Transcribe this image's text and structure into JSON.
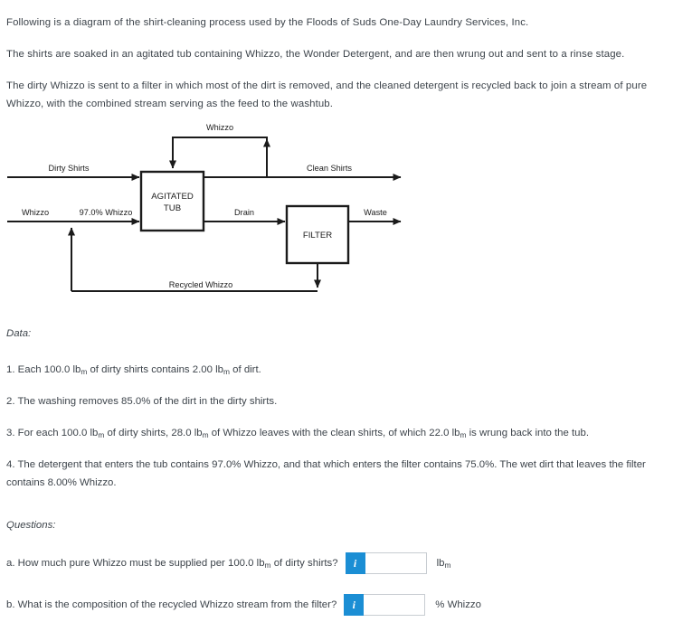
{
  "intro": {
    "p1": "Following is a diagram of the shirt-cleaning process used by the Floods of Suds One-Day Laundry Services, Inc.",
    "p2": "The shirts are soaked in an agitated tub containing Whizzo, the Wonder Detergent, and are then wrung out and sent to a rinse stage.",
    "p3": "The dirty Whizzo is sent to a filter in which most of the dirt is removed, and the cleaned detergent is recycled back to join a stream of pure Whizzo, with the combined stream serving as the feed to the washtub."
  },
  "diagram": {
    "units": {
      "tub": "AGITATED",
      "tub_line2": "TUB",
      "filter": "FILTER"
    },
    "streams": {
      "whizzo_recycle_top": "Whizzo",
      "dirty_shirts": "Dirty Shirts",
      "clean_shirts": "Clean Shirts",
      "whizzo_feed": "Whizzo",
      "mixed_feed": "97.0% Whizzo",
      "drain": "Drain",
      "waste": "Waste",
      "recycled_whizzo": "Recycled Whizzo"
    }
  },
  "data_section": {
    "heading": "Data:",
    "items": [
      {
        "pre": "1. Each 100.0 lb",
        "sub1": "m",
        "mid": " of dirty shirts contains 2.00 lb",
        "sub2": "m",
        "post": " of dirt."
      },
      {
        "pre": "2. The washing removes 85.0% of the dirt in the dirty shirts.",
        "sub1": "",
        "mid": "",
        "sub2": "",
        "post": ""
      },
      {
        "pre": "3. For each 100.0 lb",
        "sub1": "m",
        "mid": " of dirty shirts, 28.0 lb",
        "sub2": "m",
        "post": " of Whizzo leaves with the clean shirts, of which 22.0 lb",
        "sub3": "m",
        "post2": " is wrung back into the tub."
      },
      {
        "pre": "4. The detergent that enters the tub contains 97.0% Whizzo, and that which enters the filter contains 75.0%. The wet dirt that leaves the filter contains 8.00% Whizzo.",
        "sub1": "",
        "mid": "",
        "sub2": "",
        "post": ""
      }
    ]
  },
  "questions_section": {
    "heading": "Questions:",
    "items": [
      {
        "text_pre": "a. How much pure Whizzo must be supplied per 100.0 lb",
        "text_sub": "m",
        "text_post": " of dirty shirts?",
        "info_glyph": "i",
        "value": "",
        "unit_pre": "lb",
        "unit_sub": "m",
        "unit_post": ""
      },
      {
        "text_pre": "b. What is the composition of the recycled Whizzo stream from the filter?",
        "text_sub": "",
        "text_post": "",
        "info_glyph": "i",
        "value": "",
        "unit_pre": "% Whizzo",
        "unit_sub": "",
        "unit_post": ""
      }
    ]
  },
  "colors": {
    "text": "#3d444b",
    "diagram_line": "#1b1b1b",
    "info_button": "#1b8ed4",
    "input_border": "#c8cdd2"
  }
}
